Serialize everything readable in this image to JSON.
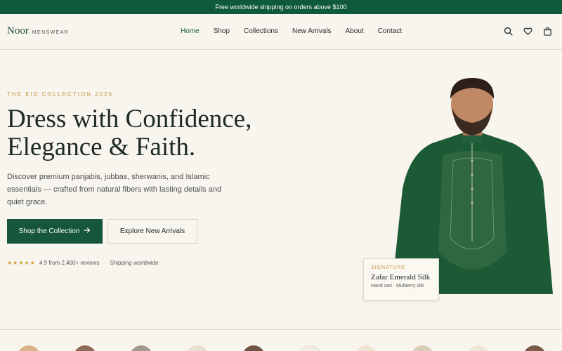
{
  "announcement": "Free worldwide shipping on orders above $100",
  "brand": {
    "name": "Noor",
    "sub": "MENSWEAR"
  },
  "nav": [
    "Home",
    "Shop",
    "Collections",
    "New Arrivals",
    "About",
    "Contact"
  ],
  "header_icons": [
    "search-icon",
    "heart-icon",
    "bag-icon"
  ],
  "hero": {
    "eyebrow": "THE EID COLLECTION 2026",
    "headline_line1": "Dress with Confidence,",
    "headline_line2": "Elegance & Faith.",
    "description": "Discover premium panjabis, jubbas, sherwanis, and Islamic essentials — crafted from natural fibers with lasting details and quiet grace.",
    "primary_button": "Shop the Collection",
    "secondary_button": "Explore New Arrivals",
    "rating_text": "4.9 from 2,400+ reviews",
    "stars": "★★★★★",
    "shipping_text": "Shipping worldwide"
  },
  "signature_card": {
    "label": "SIGNATURE",
    "title": "Zafar Emerald Silk",
    "subtitle": "Hand zari · Mulberry silk"
  },
  "colors": {
    "brand_green": "#15563c",
    "announcement_green": "#0f5a3a",
    "accent_gold": "#c4933f",
    "background": "#f8f5ee"
  }
}
